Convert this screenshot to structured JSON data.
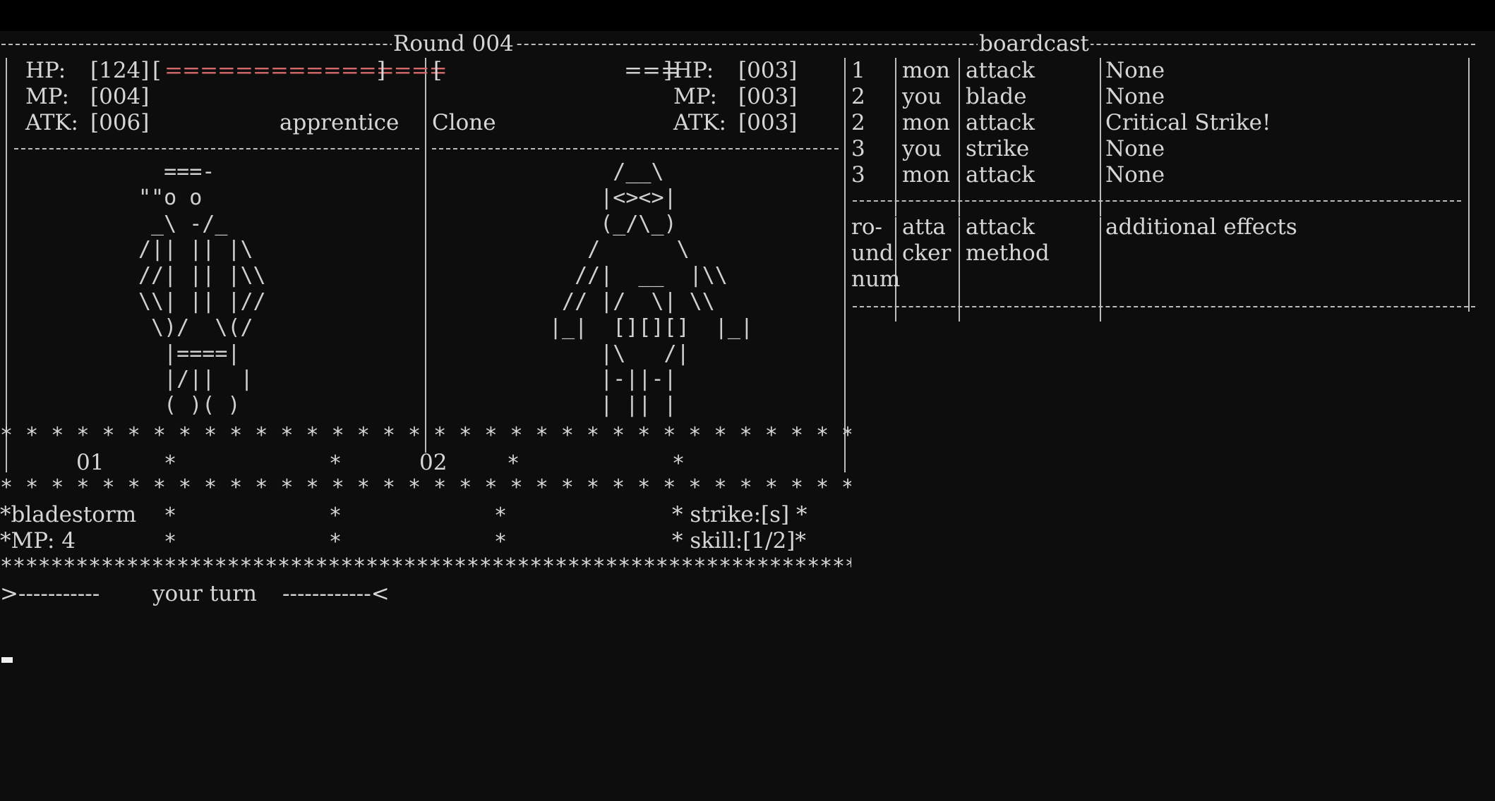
{
  "round_label": "Round 004",
  "board_title": "boardcast",
  "player": {
    "hp_label": "HP:",
    "hp_value": "[124]",
    "hp_bar_open": "[",
    "hp_bar_fill": "================",
    "hp_bar_close": " ]",
    "mp_label": "MP:",
    "mp_value": "[004]",
    "atk_label": "ATK:",
    "atk_value": "[006]",
    "class_name": "apprentice",
    "art": "  ===-\n\"\"o o\n _\\ -/_\n/|| || |\\\n//| || |\\\\\n\\\\| || |//\n \\)/  \\(/\n  |====|\n  |/||  |\n  ( )( )"
  },
  "enemy": {
    "hp_bar_open": "[",
    "hp_bar_fill": "===",
    "hp_bar_close": "]",
    "hp_label": "HP:",
    "hp_value": "[003]",
    "mp_label": "MP:",
    "mp_value": "[003]",
    "atk_label": "ATK:",
    "atk_value": "[003]",
    "name": "Clone",
    "art": "     /__\\\n    |<><>|\n    (_/\\_)\n   /      \\\n  //|  __  |\\\\\n // |/  \\| \\\\\n|_|  [][][]  |_|\n    |\\   /|\n    |-||-|\n    | || |"
  },
  "battle_log": {
    "rows": [
      {
        "round": "1",
        "attacker": "mon",
        "method": "attack",
        "effect": "None"
      },
      {
        "round": "2",
        "attacker": "you",
        "method": "blade",
        "effect": "None"
      },
      {
        "round": "2",
        "attacker": "mon",
        "method": "attack",
        "effect": "Critical Strike!"
      },
      {
        "round": "3",
        "attacker": "you",
        "method": "strike",
        "effect": "None"
      },
      {
        "round": "3",
        "attacker": "mon",
        "method": "attack",
        "effect": "None"
      }
    ],
    "header": {
      "round_l1": "ro-",
      "round_l2": "und",
      "round_l3": "num",
      "attacker_l1": "atta",
      "attacker_l2": "cker",
      "method_l1": "attack",
      "method_l2": "method",
      "effect_l1": "additional effects"
    }
  },
  "slots": {
    "slot1": "01",
    "slot2": "02"
  },
  "skills": {
    "skill_name": "*bladestorm",
    "skill_mp": "*MP: 4",
    "strike_hint": "* strike:[s] *",
    "skill_hint": "* skill:[1/2]*"
  },
  "prompt": {
    "left": ">-----------",
    "text": "your turn",
    "right": "------------<"
  }
}
